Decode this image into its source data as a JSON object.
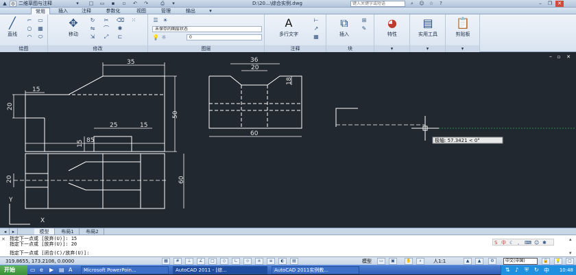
{
  "titlebar": {
    "workspace": "二维草图与注释",
    "file_path": "D:\\20...\\综合实例.dwg",
    "search_placeholder": "键入关键字或短语"
  },
  "tabs": [
    "常用",
    "插入",
    "注释",
    "参数化",
    "视图",
    "管理",
    "输出"
  ],
  "ribbon": {
    "draw_label": "直线",
    "move_label": "移动",
    "layer_state": "未保存的图层状态",
    "layer_current": "0",
    "mtext_label": "多行文字",
    "insert_label": "插入",
    "properties_label": "特性",
    "utilities_label": "实用工具",
    "clipboard_label": "剪贴板",
    "panels": [
      "绘图",
      "修改",
      "图层",
      "注释",
      "块"
    ]
  },
  "drawing": {
    "dims_front": [
      "35",
      "15",
      "20",
      "15",
      "25",
      "15",
      "50",
      "85"
    ],
    "dims_side": [
      "36",
      "20",
      "18",
      "60"
    ],
    "dims_top": [
      "20",
      "60"
    ],
    "tooltip": "极轴: 57.3421 < 0°",
    "ucs_x": "X",
    "ucs_y": "Y"
  },
  "layout_tabs": [
    "模型",
    "布局1",
    "布局2"
  ],
  "command_lines": [
    "指定下一点或 [放弃(U)]: 15",
    "指定下一点或 [放弃(U)]: 20",
    "指定下一点或 [闭合(C)/放弃(U)]:"
  ],
  "status": {
    "coords": "319.8655, 173.2108, 0.0000",
    "model": "模型",
    "scale": "人1:1",
    "ime": "中文(中国)"
  },
  "taskbar": {
    "start": "开始",
    "tasks": [
      "Microsoft PowerPoin...",
      "AutoCAD 2011 - [综...",
      "AutoCAD 2011实例教..."
    ],
    "clock": "10:48"
  }
}
